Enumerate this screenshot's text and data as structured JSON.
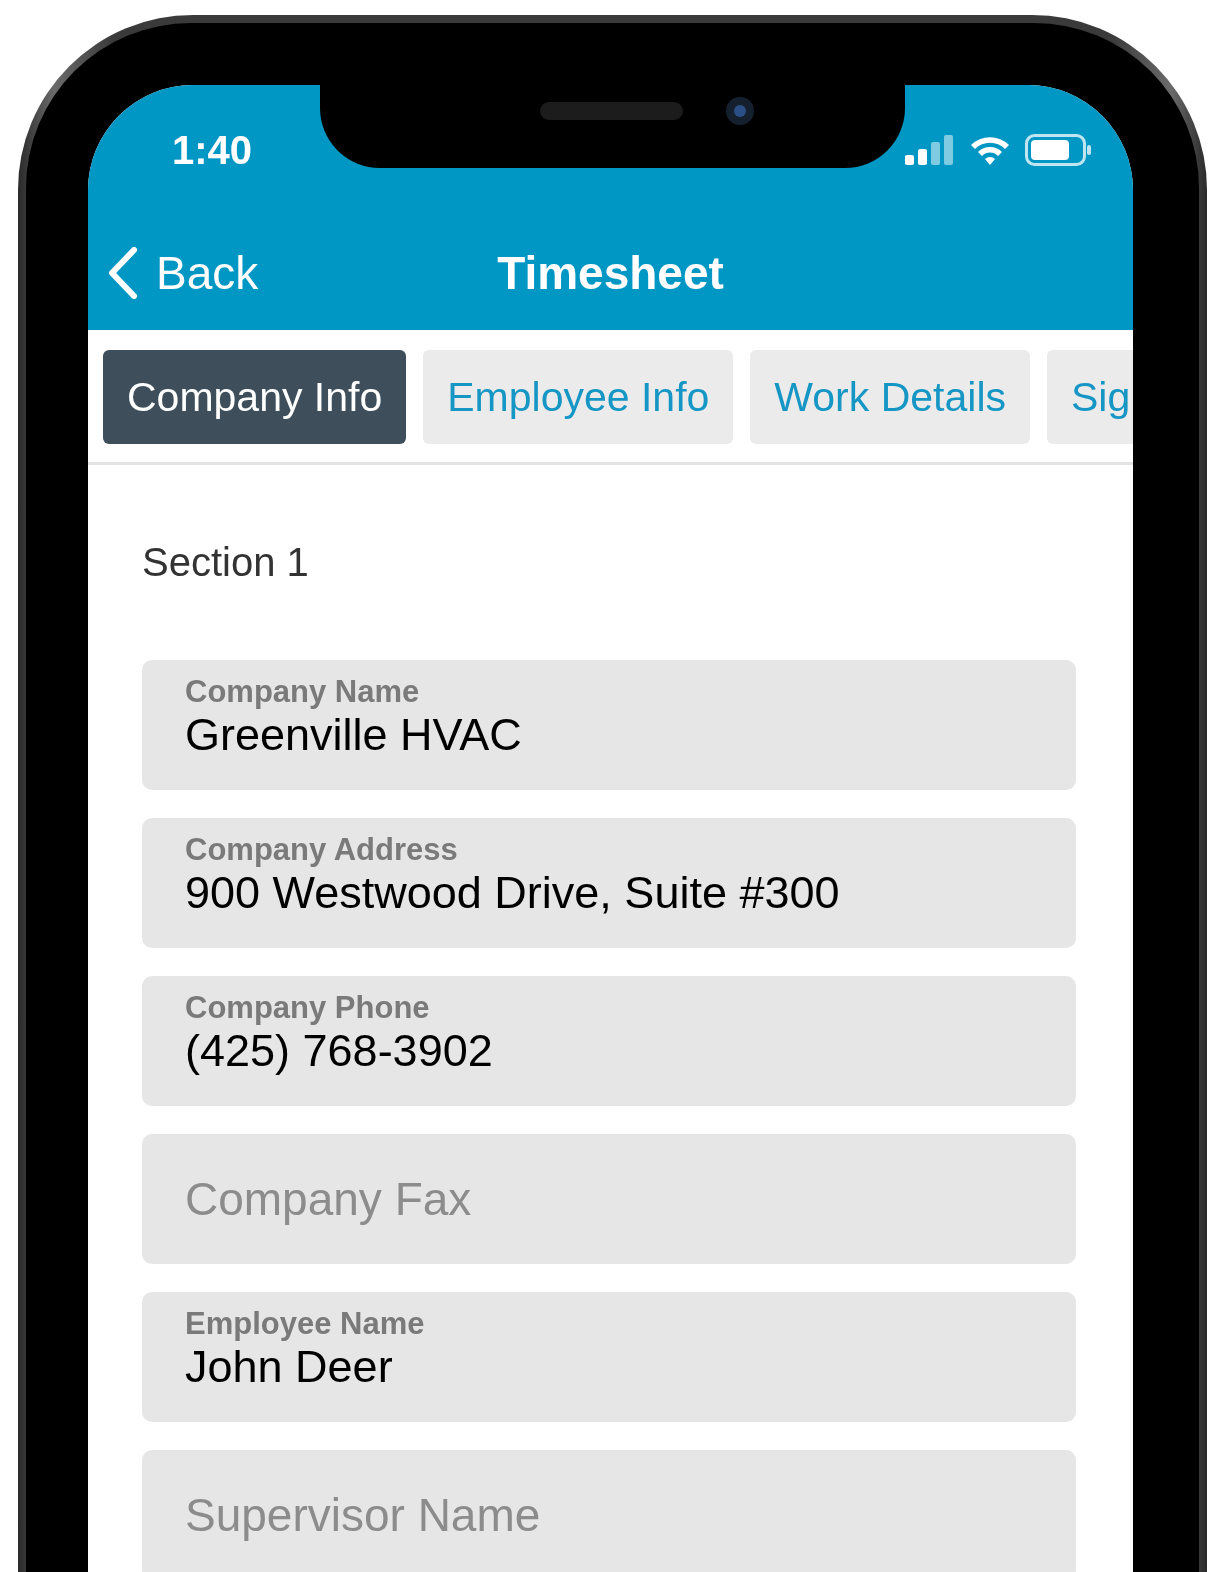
{
  "status_bar": {
    "time": "1:40"
  },
  "nav": {
    "back": "Back",
    "title": "Timesheet"
  },
  "tabs": [
    {
      "label": "Company Info",
      "selected": true
    },
    {
      "label": "Employee Info",
      "selected": false
    },
    {
      "label": "Work Details",
      "selected": false
    },
    {
      "label": "Sig",
      "selected": false
    }
  ],
  "section": {
    "title": "Section 1"
  },
  "fields": [
    {
      "label": "Company Name",
      "value": "Greenville HVAC"
    },
    {
      "label": "Company Address",
      "value": "900 Westwood Drive, Suite #300"
    },
    {
      "label": "Company Phone",
      "value": "(425) 768-3902"
    },
    {
      "placeholder": "Company Fax"
    },
    {
      "label": "Employee Name",
      "value": "John Deer"
    },
    {
      "placeholder": "Supervisor Name"
    }
  ]
}
